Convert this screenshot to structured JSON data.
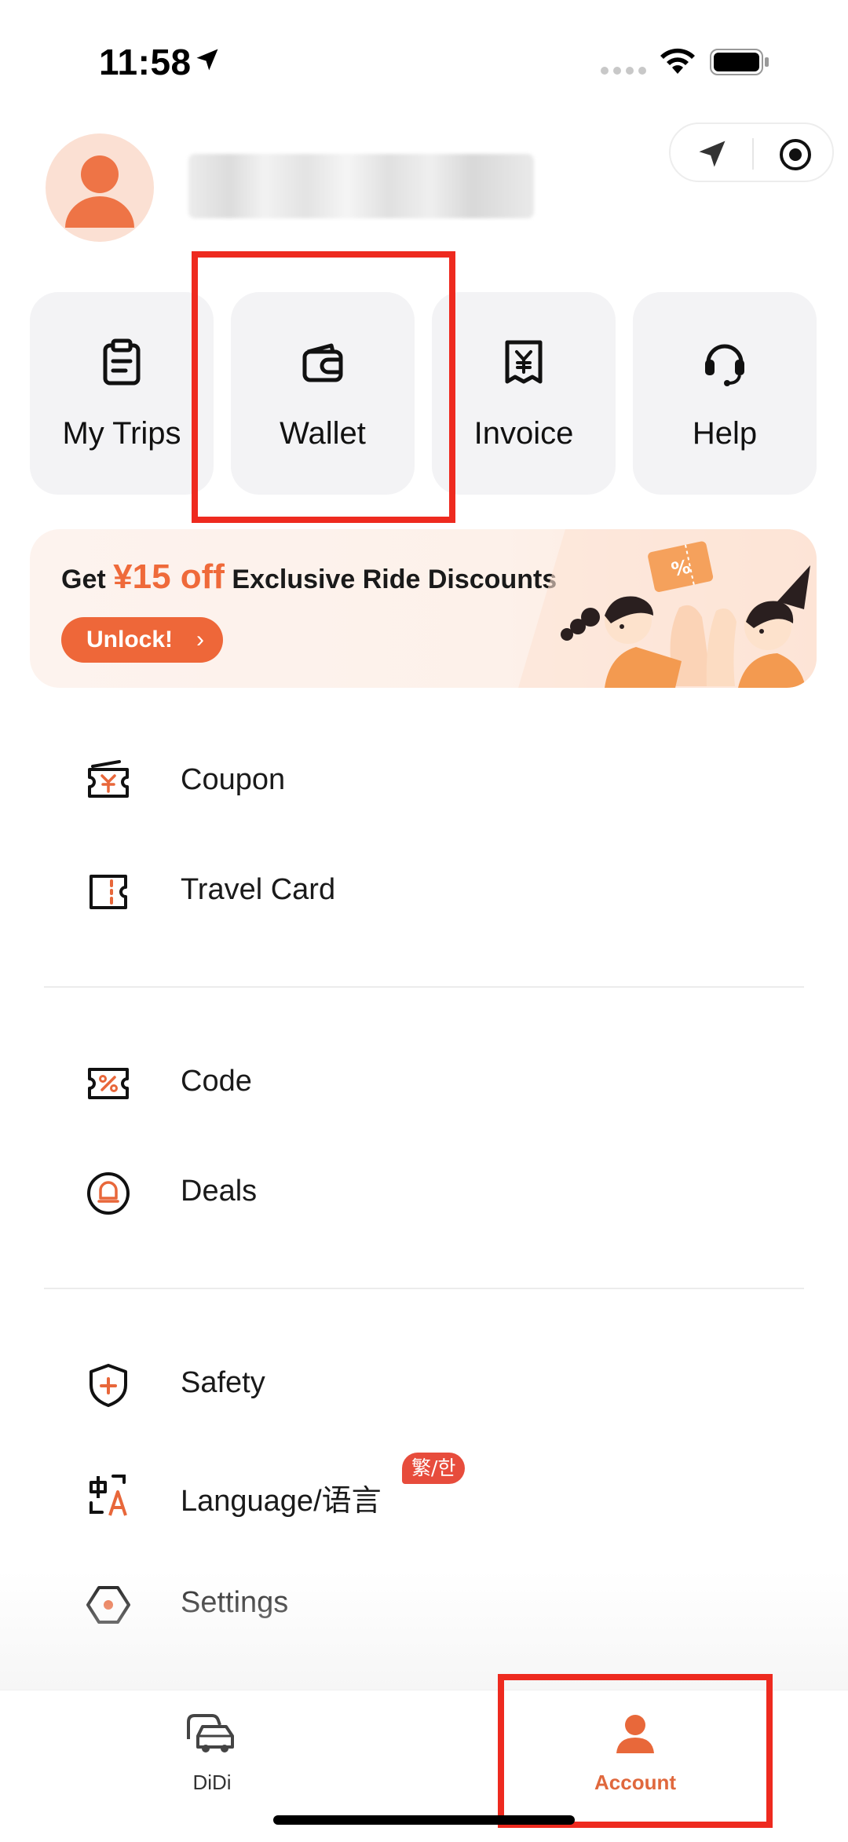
{
  "status_bar": {
    "time": "11:58"
  },
  "header": {
    "avatar_icon": "person-icon",
    "action_icons": [
      "navigation-arrow-icon",
      "target-icon"
    ]
  },
  "quick_actions": [
    {
      "label": "My Trips",
      "icon": "clipboard-icon"
    },
    {
      "label": "Wallet",
      "icon": "wallet-icon"
    },
    {
      "label": "Invoice",
      "icon": "receipt-yen-icon"
    },
    {
      "label": "Help",
      "icon": "headset-icon"
    }
  ],
  "banner": {
    "prefix": "Get ",
    "highlight": "¥15 off",
    "suffix": " Exclusive Ride Discounts",
    "button_label": "Unlock!",
    "button_chevron": "›",
    "art_badge": "%"
  },
  "menu": {
    "group1": [
      {
        "label": "Coupon",
        "icon": "coupon-yen-icon"
      },
      {
        "label": "Travel Card",
        "icon": "travel-card-icon"
      }
    ],
    "group2": [
      {
        "label": "Code",
        "icon": "percent-ticket-icon"
      },
      {
        "label": "Deals",
        "icon": "deals-icon"
      }
    ],
    "group3": [
      {
        "label": "Safety",
        "icon": "shield-plus-icon"
      },
      {
        "label": "Language/语言",
        "icon": "language-icon",
        "badge": "繁/한"
      },
      {
        "label": "Settings",
        "icon": "hexagon-settings-icon"
      }
    ]
  },
  "tabbar": {
    "tabs": [
      {
        "label": "DiDi",
        "icon": "cars-icon",
        "active": false
      },
      {
        "label": "Account",
        "icon": "person-icon",
        "active": true
      }
    ]
  },
  "colors": {
    "accent": "#EE6739",
    "tile_bg": "#F3F3F5",
    "highlight_box": "#EE2A1F",
    "badge": "#E74C3C",
    "active_tab": "#E0683D"
  }
}
